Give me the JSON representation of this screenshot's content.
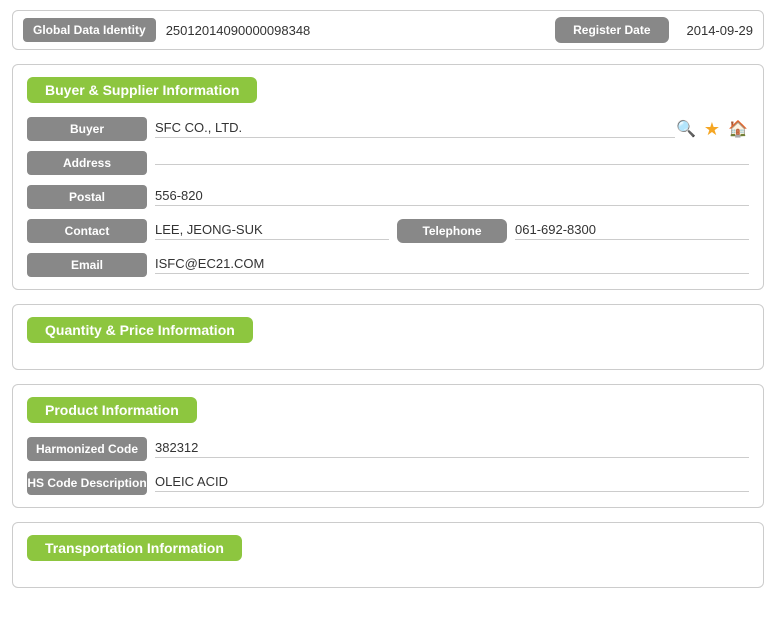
{
  "global": {
    "label": "Global Data Identity",
    "value": "25012014090000098348",
    "register_date_label": "Register Date",
    "register_date_value": "2014-09-29"
  },
  "buyer_supplier": {
    "section_title": "Buyer & Supplier Information",
    "buyer_label": "Buyer",
    "buyer_value": "SFC CO., LTD.",
    "address_label": "Address",
    "address_value": "",
    "postal_label": "Postal",
    "postal_value": "556-820",
    "contact_label": "Contact",
    "contact_value": "LEE, JEONG-SUK",
    "telephone_label": "Telephone",
    "telephone_value": "061-692-8300",
    "email_label": "Email",
    "email_value": "ISFC@EC21.COM",
    "icons": {
      "search": "🔍",
      "star": "★",
      "home": "🏠"
    }
  },
  "quantity_price": {
    "section_title": "Quantity & Price Information"
  },
  "product": {
    "section_title": "Product Information",
    "harmonized_code_label": "Harmonized Code",
    "harmonized_code_value": "382312",
    "hs_code_description_label": "HS Code Description",
    "hs_code_description_value": "OLEIC ACID"
  },
  "transportation": {
    "section_title": "Transportation Information"
  }
}
